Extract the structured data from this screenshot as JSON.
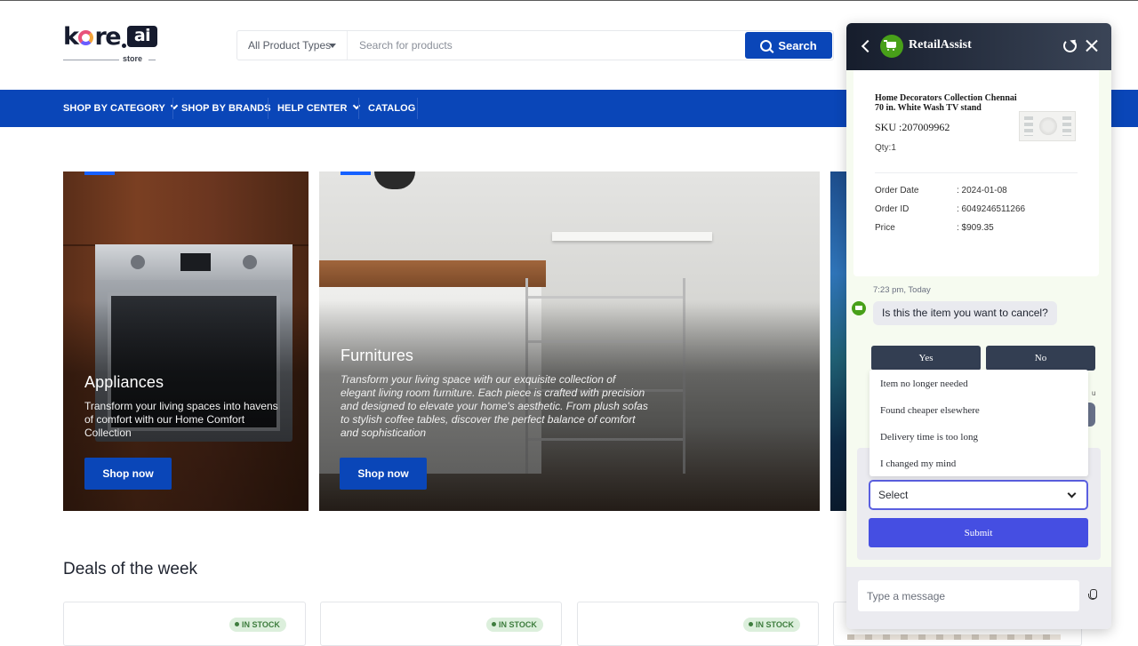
{
  "header": {
    "logo_text": "kore",
    "logo_ai": "ai",
    "logo_sub": "store",
    "product_type": "All Product Types",
    "search_placeholder": "Search for products",
    "search_button": "Search"
  },
  "nav": {
    "items": [
      {
        "label": "SHOP BY CATEGORY",
        "dropdown": true
      },
      {
        "label": "SHOP BY BRANDS",
        "dropdown": false
      },
      {
        "label": "HELP CENTER",
        "dropdown": true
      },
      {
        "label": "CATALOG",
        "dropdown": false
      }
    ]
  },
  "hero": {
    "cards": [
      {
        "title": "Appliances",
        "description": "Transform your living spaces into havens of comfort with our Home Comfort Collection",
        "button": "Shop now"
      },
      {
        "title": "Furnitures",
        "description": "Transform your living space with our exquisite collection of elegant living room furniture. Each piece is crafted with precision and designed to elevate your home's aesthetic. From plush sofas to stylish coffee tables, discover the perfect balance of comfort and sophistication",
        "button": "Shop now"
      }
    ]
  },
  "deals": {
    "title": "Deals of the week",
    "badge": "IN STOCK",
    "colors": {
      "badge_bg": "#dcefdc",
      "badge_text": "#3e7d3e"
    }
  },
  "chat": {
    "bot_name": "RetailAssist",
    "order": {
      "product_name": "Home Decorators Collection Chennai 70 in. White Wash TV stand",
      "sku": "SKU :207009962",
      "qty": "Qty:1",
      "fields": [
        {
          "label": "Order Date",
          "value": ": 2024-01-08"
        },
        {
          "label": "Order ID",
          "value": ": 6049246511266"
        },
        {
          "label": "Price",
          "value": ": $909.35"
        }
      ]
    },
    "timestamp": "7:23 pm, Today",
    "message": "Is this the item you want to cancel?",
    "choices": [
      "Yes",
      "No"
    ],
    "partial_hidden_text": "u",
    "reason_options": [
      "Item no longer needed",
      "Found cheaper elsewhere",
      "Delivery time is too long",
      "I changed my mind"
    ],
    "select_value": "Select",
    "submit_label": "Submit",
    "input_placeholder": "Type a message",
    "colors": {
      "brand_green": "#48a019",
      "submit": "#454ee2",
      "choice_btn": "#333e52"
    }
  },
  "colors": {
    "brand_blue": "#0a46b8"
  }
}
